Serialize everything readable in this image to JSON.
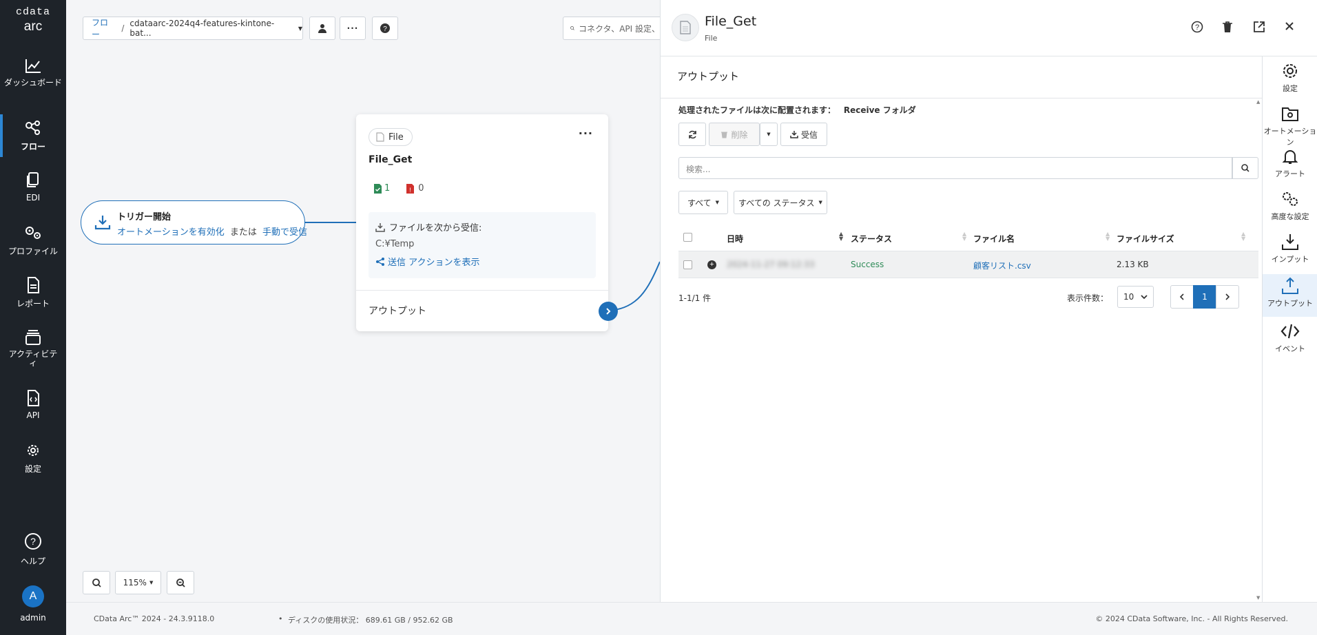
{
  "brand": {
    "line1": "cdata",
    "line2": "arc"
  },
  "nav": {
    "dashboard": "ダッシュボード",
    "flow": "フロー",
    "edi": "EDI",
    "profile": "プロファイル",
    "report": "レポート",
    "activity": "アクティビティ",
    "api": "API",
    "settings": "設定",
    "help": "ヘルプ",
    "user_initial": "A",
    "user_name": "admin"
  },
  "toolbar": {
    "breadcrumb_root": "フロー",
    "breadcrumb_sep": "/",
    "workspace": "cdataarc-2024q4-features-kintone-bat...",
    "search_placeholder": "コネクタ、API 設定、"
  },
  "trigger": {
    "title": "トリガー開始",
    "link1": "オートメーションを有効化",
    "or": "または",
    "link2": "手動で受信"
  },
  "node": {
    "type": "File",
    "name": "File_Get",
    "success_count": "1",
    "error_count": "0",
    "receive_label": "ファイルを次から受信:",
    "path": "C:¥Temp",
    "send_link": "送信 アクションを表示",
    "output_label": "アウトプット"
  },
  "zoom": {
    "level": "115%"
  },
  "panel": {
    "title": "File_Get",
    "subtitle": "File",
    "section_title": "アウトプット",
    "location_label": "処理されたファイルは次に配置されます：",
    "location_value": "Receive フォルダ",
    "delete_label": "削除",
    "receive_label": "受信",
    "search_placeholder": "検索...",
    "filter_all": "すべて",
    "filter_status": "すべての ステータス",
    "columns": [
      "日時",
      "ステータス",
      "ファイル名",
      "ファイルサイズ"
    ],
    "rows": [
      {
        "datetime": "2024-11-27 09:12:33",
        "status": "Success",
        "filename": "顧客リスト.csv",
        "size": "2.13 KB"
      }
    ],
    "range": "1-1/1 件",
    "page_size_label": "表示件数：",
    "page_size": "10",
    "current_page": "1"
  },
  "tabs": {
    "settings": "設定",
    "automation": "オートメーション",
    "alert": "アラート",
    "advanced": "高度な設定",
    "input": "インプット",
    "output": "アウトプット",
    "events": "イベント"
  },
  "footer": {
    "version": "CData Arc™ 2024 - 24.3.9118.0",
    "disk": "ディスクの使用状況： 689.61 GB / 952.62 GB",
    "copyright": "© 2024 CData Software, Inc. - All Rights Reserved."
  },
  "colors": {
    "accent": "#1f6fb8",
    "sidebar": "#1e2329",
    "success": "#2e8b57",
    "error": "#d0312d"
  }
}
